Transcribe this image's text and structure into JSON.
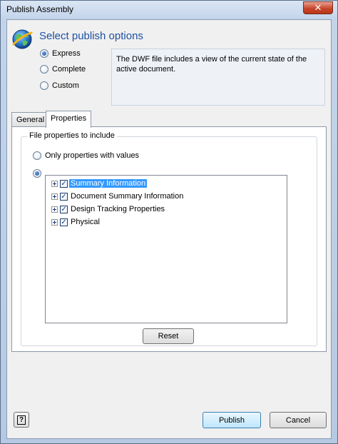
{
  "window": {
    "title": "Publish Assembly",
    "close_glyph": "✕"
  },
  "header": {
    "title": "Select publish options",
    "icon": "globe-publish-icon"
  },
  "publish_options": [
    {
      "label": "Express",
      "checked": true
    },
    {
      "label": "Complete",
      "checked": false
    },
    {
      "label": "Custom",
      "checked": false
    }
  ],
  "description": "The DWF file includes a view of the current state of the active document.",
  "tabs": [
    {
      "label": "General",
      "active": false
    },
    {
      "label": "Properties",
      "active": true
    }
  ],
  "properties_panel": {
    "group_label": "File properties to include",
    "option_values_only": "Only properties with values",
    "tree": [
      {
        "label": "Summary Information",
        "checked": true,
        "selected": true
      },
      {
        "label": "Document Summary Information",
        "checked": true,
        "selected": false
      },
      {
        "label": "Design Tracking Properties",
        "checked": true,
        "selected": false
      },
      {
        "label": "Physical",
        "checked": true,
        "selected": false
      }
    ],
    "reset_label": "Reset"
  },
  "footer": {
    "help_glyph": "?",
    "publish_label": "Publish",
    "cancel_label": "Cancel"
  },
  "colors": {
    "accent_title": "#1e50a2",
    "selection": "#3399ff",
    "close_button": "#c9462c"
  }
}
